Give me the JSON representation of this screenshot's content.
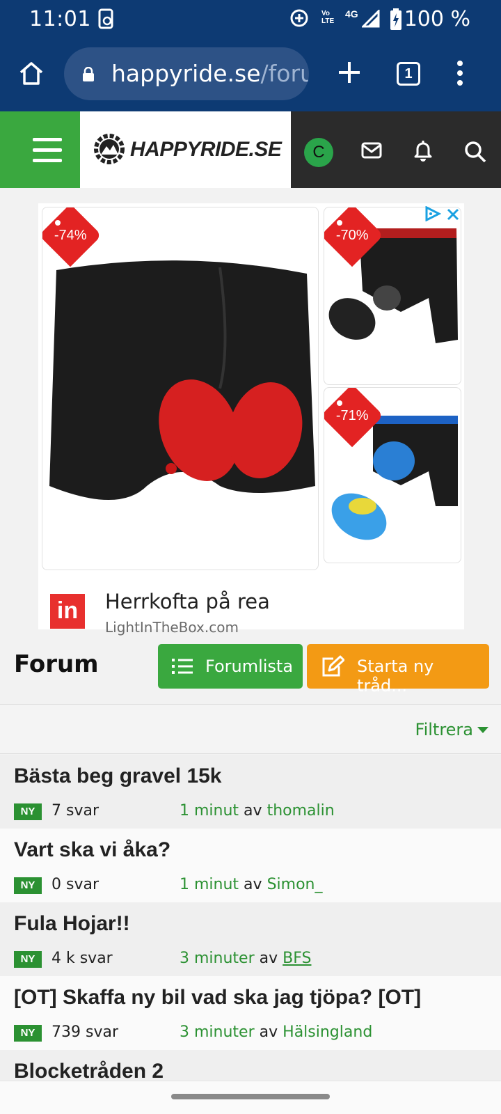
{
  "status_bar": {
    "time": "11:01",
    "network": "4G",
    "volte": "Vo LTE",
    "battery": "100 %"
  },
  "browser": {
    "url_host": "happyride.se",
    "url_path": "/foru",
    "tab_count": "1"
  },
  "site": {
    "logo_text": "HAPPYRIDE.SE",
    "avatar_initial": "C"
  },
  "ad": {
    "badges": [
      "-74%",
      "-70%",
      "-71%"
    ],
    "headline": "Herrkofta på rea",
    "domain": "LightInTheBox.com",
    "advertiser_logo": "in"
  },
  "forum": {
    "title": "Forum",
    "forumlista_label": "Forumlista",
    "start_label": "Starta ny tråd...",
    "filter_label": "Filtrera"
  },
  "threads": [
    {
      "title": "Bästa beg gravel 15k",
      "badge": "NY",
      "replies": "7 svar",
      "time": "1 minut",
      "by": "av",
      "user": "thomalin"
    },
    {
      "title": "Vart ska vi åka?",
      "badge": "NY",
      "replies": "0 svar",
      "time": "1 minut",
      "by": "av",
      "user": "Simon_"
    },
    {
      "title": "Fula Hojar!!",
      "badge": "NY",
      "replies": "4 k svar",
      "time": "3 minuter",
      "by": "av",
      "user": "BFS"
    },
    {
      "title": "[OT] Skaffa ny bil vad ska jag tjöpa? [OT]",
      "badge": "NY",
      "replies": "739 svar",
      "time": "3 minuter",
      "by": "av",
      "user": "Hälsingland"
    },
    {
      "title": "Blocketråden 2"
    }
  ],
  "colors": {
    "header_blue": "#0d3a73",
    "brand_green": "#3aa83f",
    "orange": "#f39a14",
    "link_green": "#2b9132",
    "sale_red": "#e32323"
  }
}
